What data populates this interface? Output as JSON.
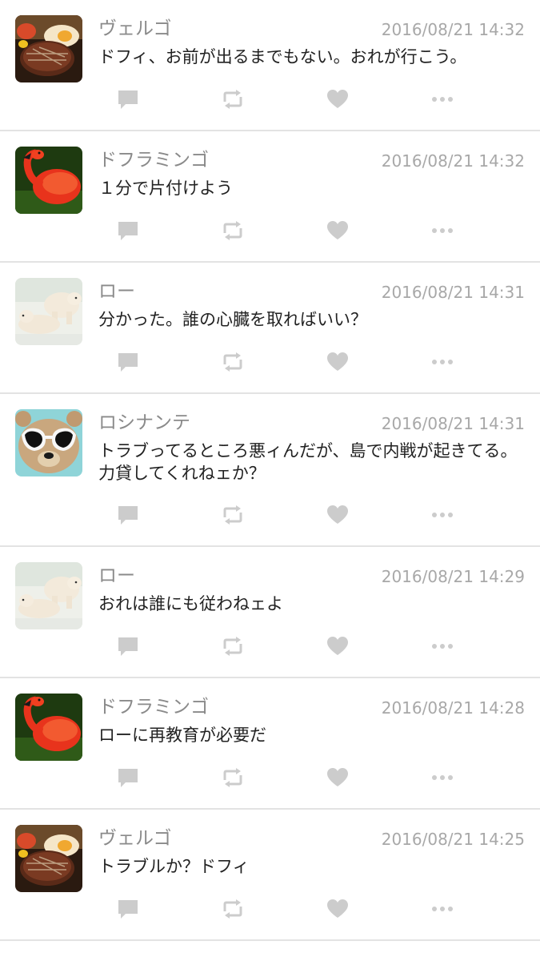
{
  "posts": [
    {
      "user": "ヴェルゴ",
      "avatar": "steak-avatar",
      "time": "2016/08/21 14:32",
      "text": "ドフィ、お前が出るまでもない。おれが行こう。"
    },
    {
      "user": "ドフラミンゴ",
      "avatar": "flamingo-avatar",
      "time": "2016/08/21 14:32",
      "text": "１分で片付けよう"
    },
    {
      "user": "ロー",
      "avatar": "polar-bear-avatar",
      "time": "2016/08/21 14:31",
      "text": "分かった。誰の心臓を取ればいい？"
    },
    {
      "user": "ロシナンテ",
      "avatar": "teddy-bear-avatar",
      "time": "2016/08/21 14:31",
      "text": "トラブってるところ悪ィんだが、島で内戦が起きてる。力貸してくれねェか？"
    },
    {
      "user": "ロー",
      "avatar": "polar-bear-avatar",
      "time": "2016/08/21 14:29",
      "text": "おれは誰にも従わねェよ"
    },
    {
      "user": "ドフラミンゴ",
      "avatar": "flamingo-avatar",
      "time": "2016/08/21 14:28",
      "text": "ローに再教育が必要だ"
    },
    {
      "user": "ヴェルゴ",
      "avatar": "steak-avatar",
      "time": "2016/08/21 14:25",
      "text": "トラブルか？ドフィ"
    }
  ],
  "action_icons": [
    "comment-icon",
    "retweet-icon",
    "heart-icon",
    "more-icon"
  ],
  "colors": {
    "icon": "#cccccc",
    "name": "#8a8a8a",
    "timestamp": "#a8a8a8",
    "divider": "#e3e3e3"
  }
}
